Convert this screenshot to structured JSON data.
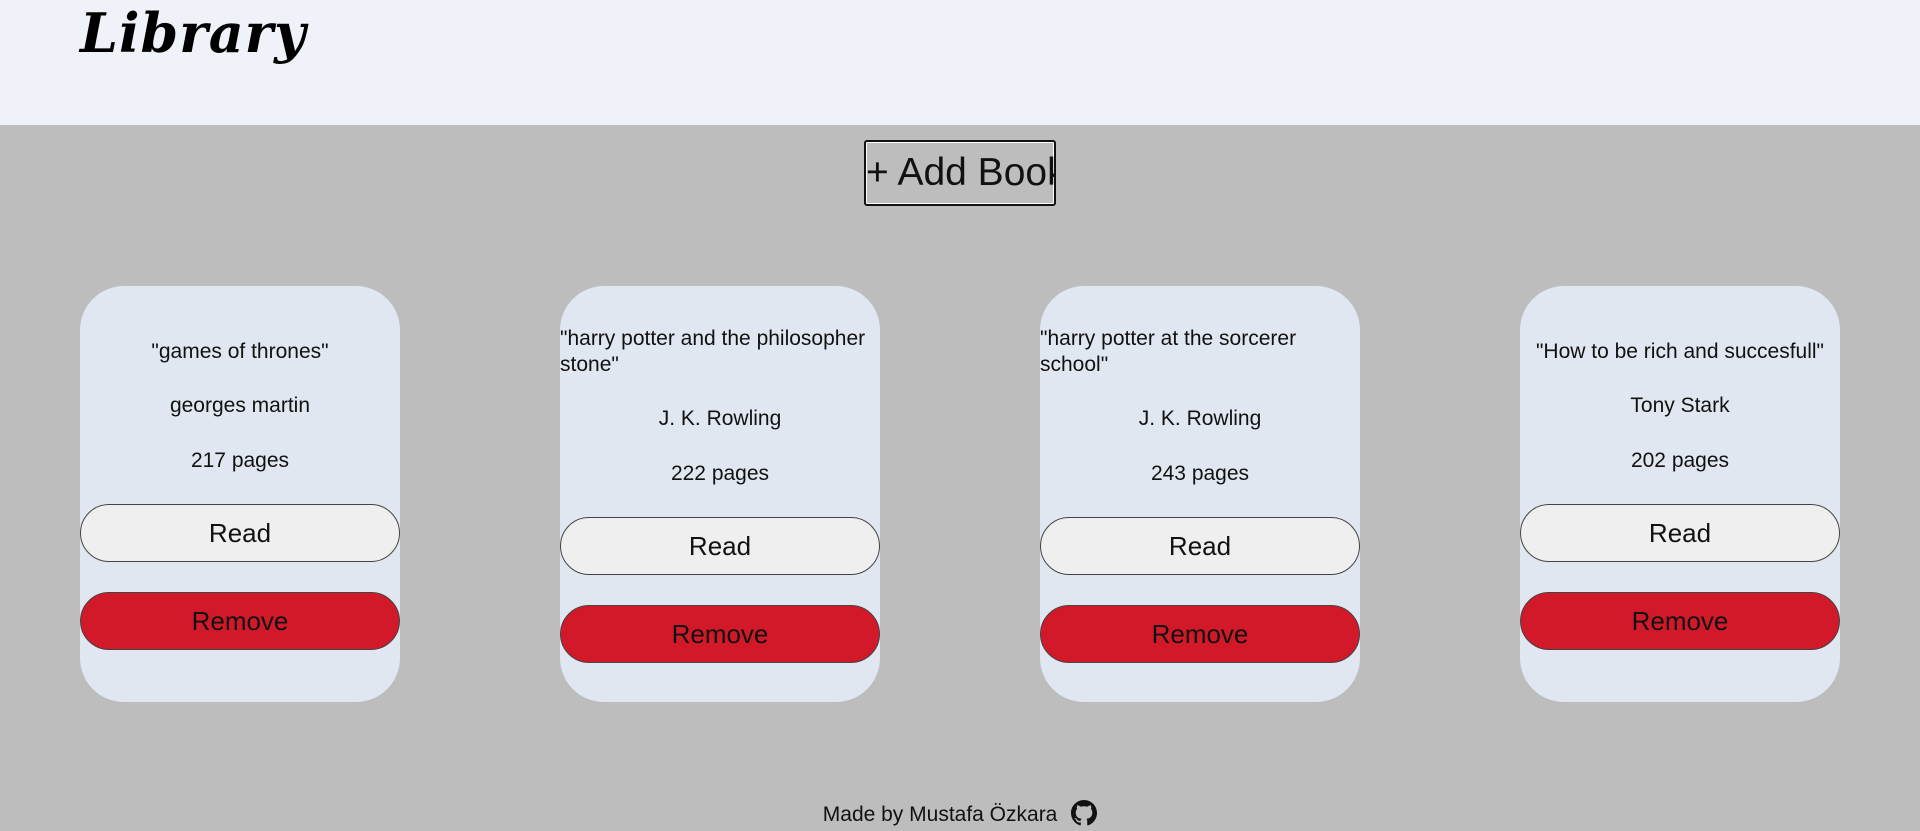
{
  "header": {
    "title": "Library"
  },
  "toolbar": {
    "add_label": "+ Add Book"
  },
  "books": [
    {
      "title": "\"games of thrones\"",
      "author": "georges martin",
      "pages": "217 pages",
      "read_label": "Read",
      "remove_label": "Remove"
    },
    {
      "title": "\"harry potter and the philosopher stone\"",
      "author": "J. K. Rowling",
      "pages": "222 pages",
      "read_label": "Read",
      "remove_label": "Remove"
    },
    {
      "title": "\"harry potter at the sorcerer school\"",
      "author": "J. K. Rowling",
      "pages": "243 pages",
      "read_label": "Read",
      "remove_label": "Remove"
    },
    {
      "title": "\"How to be rich and succesfull\"",
      "author": "Tony Stark",
      "pages": "202 pages",
      "read_label": "Read",
      "remove_label": "Remove"
    }
  ],
  "footer": {
    "credit": "Made by Mustafa Özkara",
    "icon": "github-icon"
  },
  "colors": {
    "header_bg": "#eff3f9",
    "page_bg": "#bdbdbd",
    "card_bg": "#e1e7f0",
    "read_button": "#efefef",
    "remove_button": "#d2192a"
  }
}
